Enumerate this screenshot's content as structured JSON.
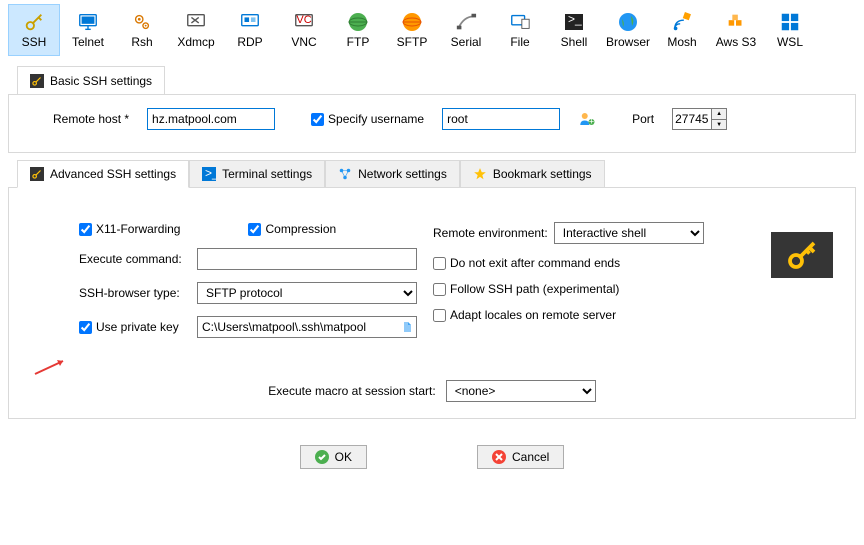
{
  "toolbar": [
    {
      "id": "ssh",
      "label": "SSH",
      "active": true
    },
    {
      "id": "telnet",
      "label": "Telnet"
    },
    {
      "id": "rsh",
      "label": "Rsh"
    },
    {
      "id": "xdmcp",
      "label": "Xdmcp"
    },
    {
      "id": "rdp",
      "label": "RDP"
    },
    {
      "id": "vnc",
      "label": "VNC"
    },
    {
      "id": "ftp",
      "label": "FTP"
    },
    {
      "id": "sftp",
      "label": "SFTP"
    },
    {
      "id": "serial",
      "label": "Serial"
    },
    {
      "id": "file",
      "label": "File"
    },
    {
      "id": "shell",
      "label": "Shell"
    },
    {
      "id": "browser",
      "label": "Browser"
    },
    {
      "id": "mosh",
      "label": "Mosh"
    },
    {
      "id": "awss3",
      "label": "Aws S3"
    },
    {
      "id": "wsl",
      "label": "WSL"
    }
  ],
  "basic": {
    "title": "Basic SSH settings",
    "remote_host_label": "Remote host *",
    "remote_host": "hz.matpool.com",
    "specify_username_label": "Specify username",
    "specify_username": true,
    "username": "root",
    "port_label": "Port",
    "port": "27745"
  },
  "tabs": {
    "advanced": "Advanced SSH settings",
    "terminal": "Terminal settings",
    "network": "Network settings",
    "bookmark": "Bookmark settings"
  },
  "advanced": {
    "x11": "X11-Forwarding",
    "x11_checked": true,
    "compression": "Compression",
    "compression_checked": true,
    "remote_env_label": "Remote environment:",
    "remote_env": "Interactive shell",
    "exec_cmd_label": "Execute command:",
    "exec_cmd": "",
    "no_exit": "Do not exit after command ends",
    "no_exit_checked": false,
    "browser_type_label": "SSH-browser type:",
    "browser_type": "SFTP protocol",
    "follow_ssh": "Follow SSH path (experimental)",
    "follow_ssh_checked": false,
    "private_key": "Use private key",
    "private_key_checked": true,
    "private_key_path": "C:\\Users\\matpool\\.ssh\\matpool",
    "adapt_locales": "Adapt locales on remote server",
    "adapt_locales_checked": false,
    "macro_label": "Execute macro at session start:",
    "macro": "<none>"
  },
  "footer": {
    "ok": "OK",
    "cancel": "Cancel"
  }
}
